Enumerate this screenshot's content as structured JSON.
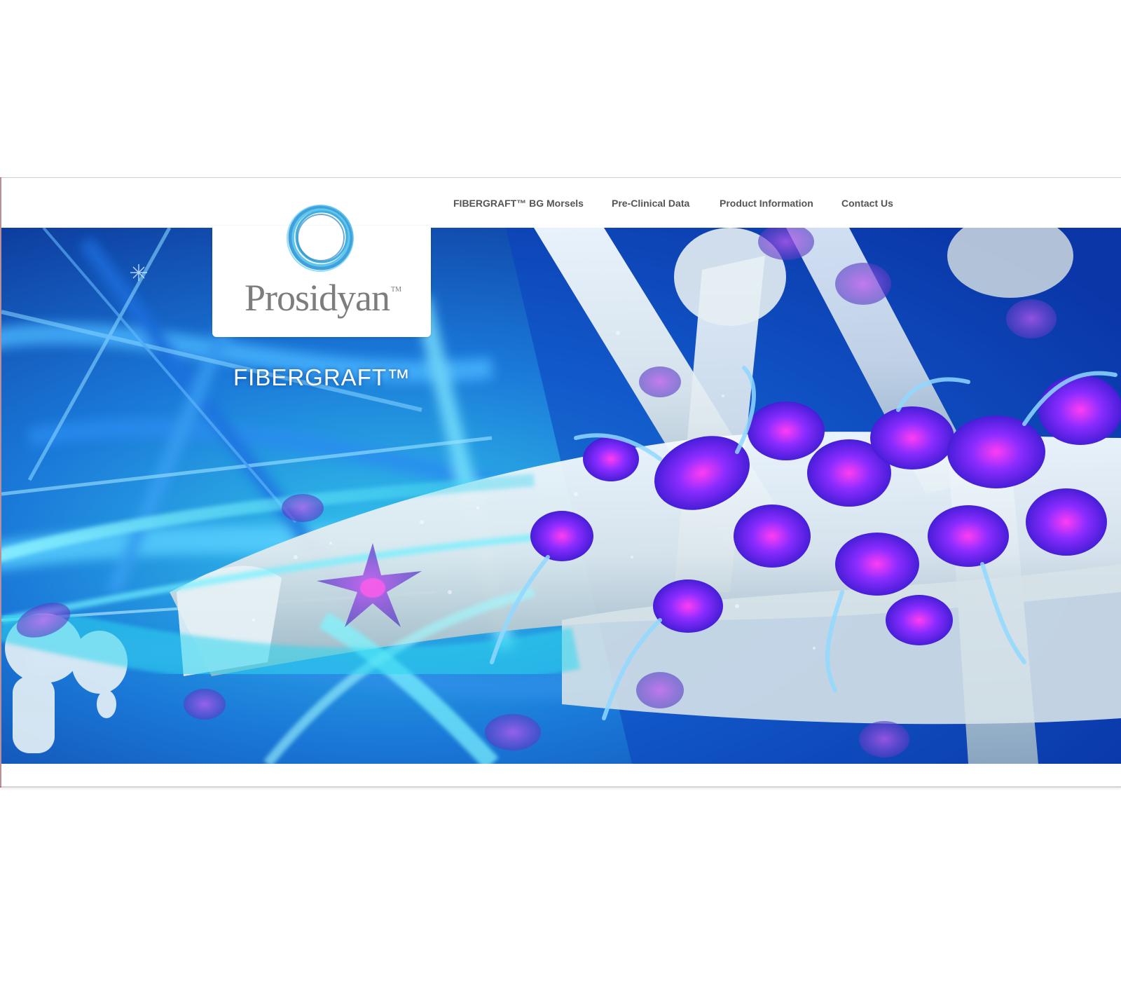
{
  "nav": {
    "items": [
      {
        "label": "FIBERGRAFT™ BG Morsels"
      },
      {
        "label": "Pre-Clinical Data"
      },
      {
        "label": "Product Information"
      },
      {
        "label": "Contact Us"
      }
    ]
  },
  "logo": {
    "wordmark": "Prosidyan",
    "trademark": "TM",
    "icon": "blue-ring-logo-icon"
  },
  "hero": {
    "title": "FIBERGRAFT™",
    "image": "fibergraft-scaffold-cells-illustration"
  },
  "colors": {
    "accent": "#2aa7de",
    "nav_text": "#555555",
    "wordmark": "#7d7d80",
    "hero_deep": "#0a3aa0",
    "hero_cyan": "#3fd6ef",
    "cell_violet": "#6b2bff",
    "cell_magenta": "#ff3df2"
  }
}
